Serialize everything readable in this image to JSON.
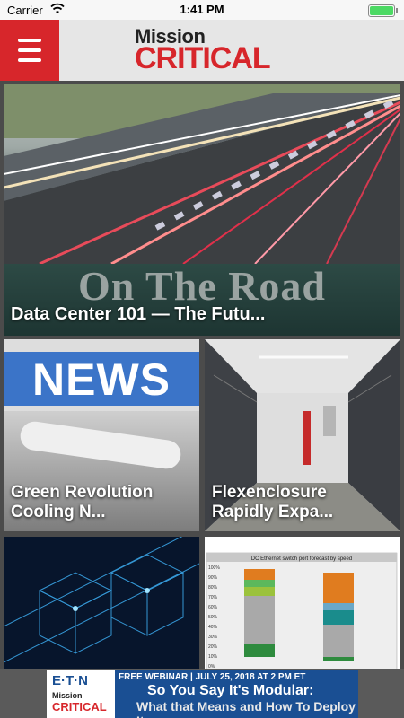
{
  "status_bar": {
    "carrier": "Carrier",
    "time": "1:41 PM"
  },
  "header": {
    "logo_line1": "Mission",
    "logo_line2": "CRITICAL",
    "accent_color": "#d7262b"
  },
  "feed": {
    "hero": {
      "banner_text": "On The Road",
      "title": "Data Center 101 — The Futu..."
    },
    "cards": [
      {
        "banner_text": "NEWS",
        "title_line1": "Green Revolution",
        "title_line2": "Cooling N..."
      },
      {
        "title_line1": "Flexenclosure",
        "title_line2": "Rapidly Expa..."
      }
    ],
    "chart_card": {
      "title": "DC Ethernet switch port forecast by speed",
      "y_ticks": [
        "100%",
        "90%",
        "80%",
        "70%",
        "60%",
        "50%",
        "40%",
        "30%",
        "20%",
        "10%",
        "0%"
      ]
    }
  },
  "ad": {
    "brand": "E·T·N",
    "brand_secondary_top": "Mission",
    "brand_secondary_bottom": "CRITICAL",
    "line1": "FREE WEBINAR  |  JULY 25, 2018 AT 2 PM ET",
    "line2": "So You Say It's Modular:",
    "line3": "What that Means and How To Deploy It"
  }
}
